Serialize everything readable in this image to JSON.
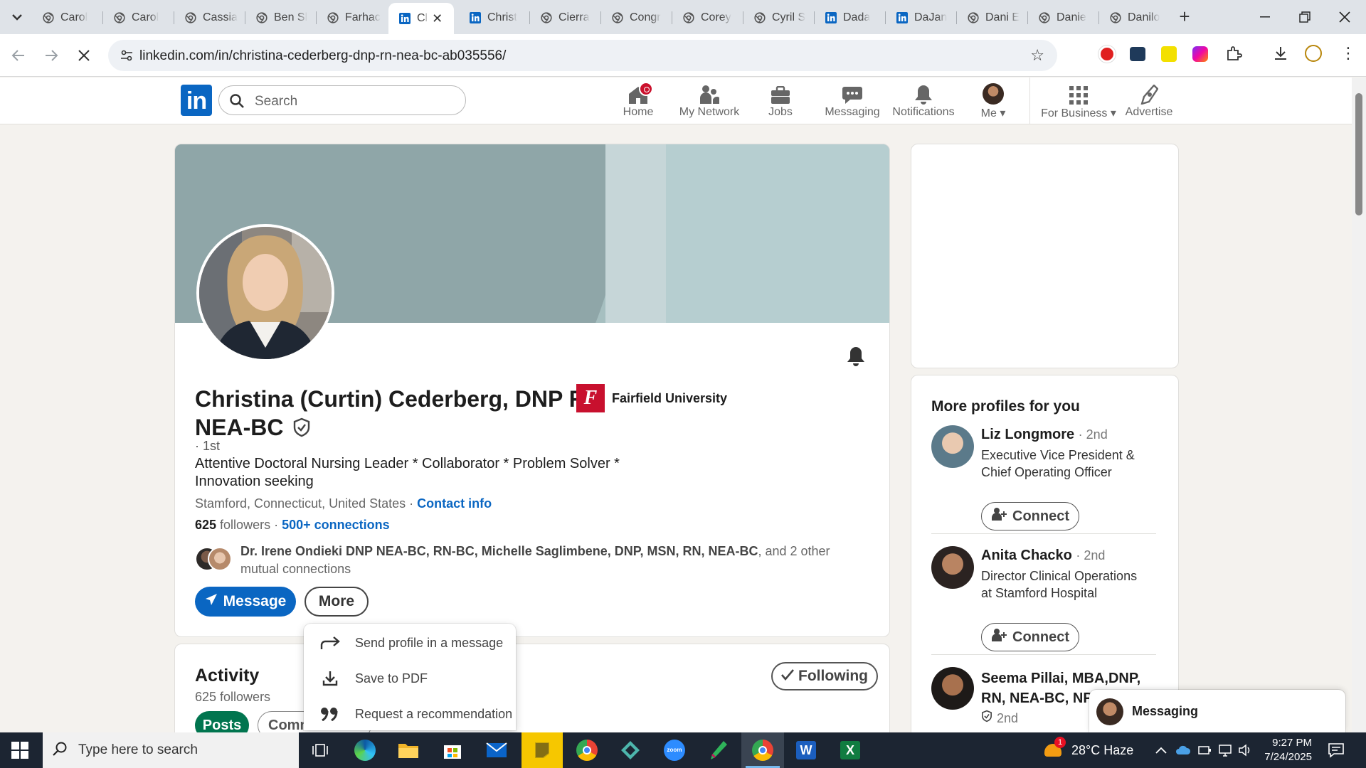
{
  "browser": {
    "tabs": [
      {
        "title": "Carol",
        "icon": "chromium-icon"
      },
      {
        "title": "Carol",
        "icon": "chromium-icon"
      },
      {
        "title": "Cassia",
        "icon": "chromium-icon"
      },
      {
        "title": "Ben Sl",
        "icon": "chromium-icon"
      },
      {
        "title": "Farhac",
        "icon": "chromium-icon"
      },
      {
        "title": "Cl",
        "icon": "linkedin-icon",
        "active": true
      },
      {
        "title": "Christ",
        "icon": "linkedin-icon"
      },
      {
        "title": "Cierra",
        "icon": "chromium-icon"
      },
      {
        "title": "Congr",
        "icon": "chromium-icon"
      },
      {
        "title": "Corey",
        "icon": "chromium-icon"
      },
      {
        "title": "Cyril S",
        "icon": "chromium-icon"
      },
      {
        "title": "Dada",
        "icon": "linkedin-icon"
      },
      {
        "title": "DaJan",
        "icon": "linkedin-icon"
      },
      {
        "title": "Dani E",
        "icon": "chromium-icon"
      },
      {
        "title": "Danie",
        "icon": "chromium-icon"
      },
      {
        "title": "Danilo",
        "icon": "chromium-icon"
      }
    ],
    "url": "linkedin.com/in/christina-cederberg-dnp-rn-nea-bc-ab035556/"
  },
  "linkedin": {
    "logo": "in",
    "search_placeholder": "Search",
    "nav": [
      {
        "label": "Home",
        "icon": "home-icon"
      },
      {
        "label": "My Network",
        "icon": "network-icon"
      },
      {
        "label": "Jobs",
        "icon": "briefcase-icon"
      },
      {
        "label": "Messaging",
        "icon": "messaging-icon"
      },
      {
        "label": "Notifications",
        "icon": "bell-icon"
      },
      {
        "label": "Me",
        "icon": "avatar"
      },
      {
        "label": "For Business",
        "icon": "grid-icon"
      },
      {
        "label": "Advertise",
        "icon": "compass-icon"
      }
    ]
  },
  "profile": {
    "name": "Christina (Curtin) Cederberg, DNP RN NEA-BC",
    "degree": "· 1st",
    "headline": "Attentive Doctoral Nursing Leader * Collaborator * Problem Solver * Innovation seeking",
    "location": "Stamford, Connecticut, United States",
    "location_sep": " · ",
    "contact_info": "Contact info",
    "followers_count": "625",
    "followers_label": " followers",
    "followers_sep": " · ",
    "connections": "500+ connections",
    "mutual_names": "Dr. Irene Ondieki DNP NEA-BC, RN-BC, Michelle Saglimbene, DNP, MSN, RN, NEA-BC",
    "mutual_suffix": ", and 2 other mutual connections",
    "school": "Fairfield University",
    "school_logo": "F",
    "message_button": "Message",
    "more_button": "More"
  },
  "more_menu": [
    {
      "label": "Send profile in a message",
      "icon": "share-arrow-icon"
    },
    {
      "label": "Save to PDF",
      "icon": "download-icon"
    },
    {
      "label": "Request a recommendation",
      "icon": "quote-icon"
    }
  ],
  "activity": {
    "title": "Activity",
    "followers": "625 followers",
    "following_button": "Following",
    "tabs": [
      "Posts",
      "Comments"
    ]
  },
  "rail": {
    "title": "More profiles for you",
    "profiles": [
      {
        "name": "Liz Longmore",
        "degree": "· 2nd",
        "title": "Executive Vice President & Chief Operating Officer",
        "button": "Connect"
      },
      {
        "name": "Anita Chacko",
        "degree": "· 2nd",
        "title": "Director Clinical Operations at Stamford Hospital",
        "button": "Connect"
      },
      {
        "name": "Seema Pillai, MBA,DNP, RN, NEA-BC, NPD",
        "degree": "2nd",
        "title": ""
      }
    ]
  },
  "messaging_bar": "Messaging",
  "taskbar": {
    "search_placeholder": "Type here to search",
    "weather": "28°C  Haze",
    "weather_badge": "1",
    "time": "9:27 PM",
    "date": "7/24/2025"
  },
  "colors": {
    "linkedin_blue": "#0a66c2",
    "following_green": "#01754f",
    "notification_red": "#cb112d"
  }
}
